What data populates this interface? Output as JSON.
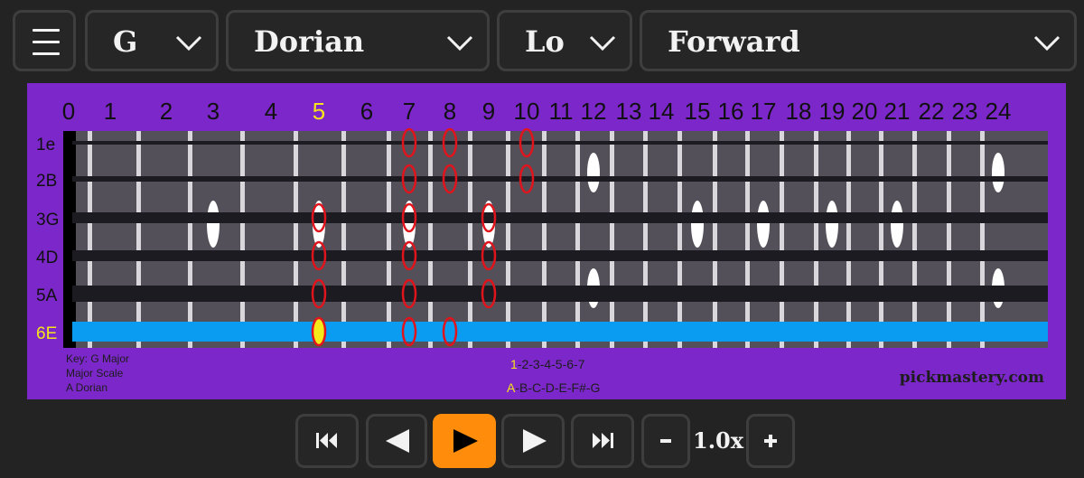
{
  "toolbar": {
    "menu_icon": "hamburger-icon",
    "key": "G",
    "mode": "Dorian",
    "position": "Lo",
    "direction": "Forward",
    "dropdown_icon": "chevron-down-icon"
  },
  "fretboard": {
    "fret_numbers": [
      "0",
      "1",
      "2",
      "3",
      "4",
      "5",
      "6",
      "7",
      "8",
      "9",
      "10",
      "11",
      "12",
      "13",
      "14",
      "15",
      "16",
      "17",
      "18",
      "19",
      "20",
      "21",
      "22",
      "23",
      "24"
    ],
    "highlighted_fret": "5",
    "string_labels": [
      "1e",
      "2B",
      "3G",
      "4D",
      "5A",
      "6E"
    ],
    "highlighted_string": "6E",
    "inlay_frets_single": [
      3,
      5,
      7,
      9,
      15,
      17,
      19,
      21
    ],
    "inlay_frets_double": [
      12,
      24
    ],
    "scale_notes": [
      {
        "string": 1,
        "fret": 7
      },
      {
        "string": 1,
        "fret": 8
      },
      {
        "string": 1,
        "fret": 10
      },
      {
        "string": 2,
        "fret": 7
      },
      {
        "string": 2,
        "fret": 8
      },
      {
        "string": 2,
        "fret": 10
      },
      {
        "string": 3,
        "fret": 5
      },
      {
        "string": 3,
        "fret": 7
      },
      {
        "string": 3,
        "fret": 9
      },
      {
        "string": 4,
        "fret": 5
      },
      {
        "string": 4,
        "fret": 7
      },
      {
        "string": 4,
        "fret": 9
      },
      {
        "string": 5,
        "fret": 5
      },
      {
        "string": 5,
        "fret": 7
      },
      {
        "string": 5,
        "fret": 9
      },
      {
        "string": 6,
        "fret": 7
      },
      {
        "string": 6,
        "fret": 8
      }
    ],
    "current_note": {
      "string": 6,
      "fret": 5
    },
    "info_lines": [
      "Key: G Major",
      "Major Scale",
      "A Dorian"
    ],
    "degrees": {
      "first": "1",
      "rest": "-2-3-4-5-6-7"
    },
    "notes": {
      "first": "A",
      "rest": "-B-C-D-E-F#-G"
    },
    "watermark": "pickmastery.com",
    "colors": {
      "background": "#7c27c9",
      "note_ring": "#e0141c",
      "current_note": "#f5e91a",
      "highlight": "#f5e51a",
      "active_string": "#0a9cf0"
    }
  },
  "transport": {
    "first_icon": "skip-to-start-icon",
    "prev_icon": "previous-icon",
    "play_icon": "play-icon",
    "next_icon": "next-icon",
    "last_icon": "skip-to-end-icon",
    "slower_icon": "minus-icon",
    "speed": "1.0x",
    "faster_icon": "plus-icon",
    "play_color": "#ff8c0a"
  }
}
